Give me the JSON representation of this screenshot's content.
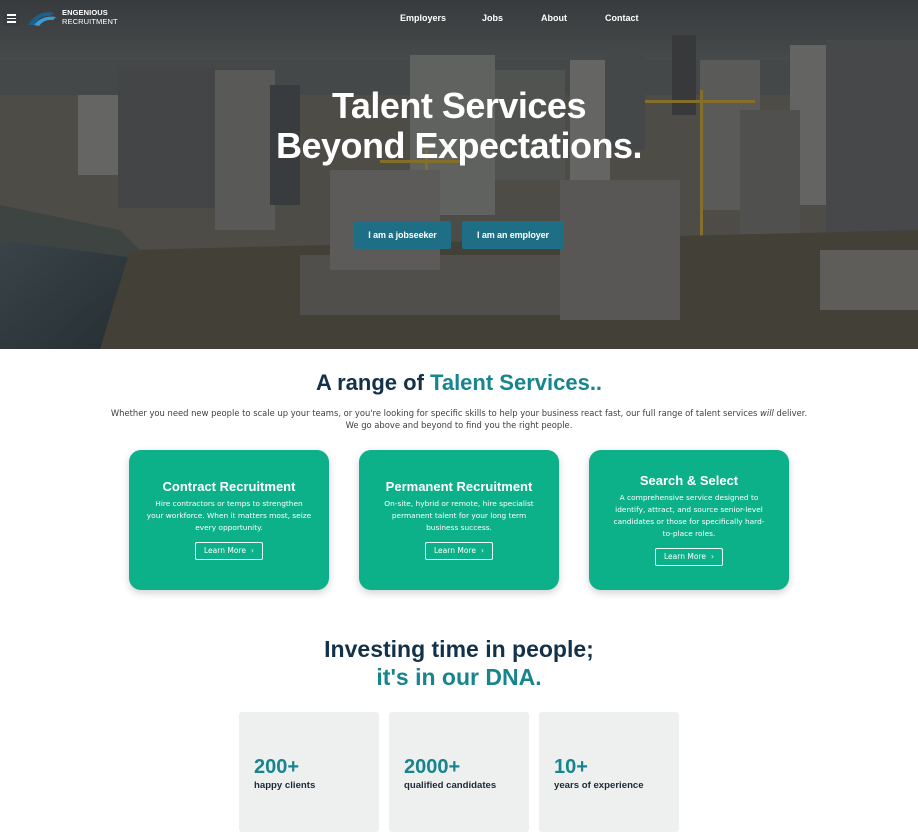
{
  "brand": {
    "line1": "ENGENIOUS",
    "line2": "RECRUITMENT"
  },
  "nav": {
    "items": [
      "Employers",
      "Jobs",
      "About",
      "Contact"
    ]
  },
  "hero": {
    "title_line1": "Talent Services",
    "title_line2": "Beyond Expectations.",
    "cta_jobseeker": "I am a jobseeker",
    "cta_employer": "I am an employer"
  },
  "services": {
    "title_prefix": "A range of ",
    "title_accent": "Talent Services..",
    "intro_line1_a": "Whether you need new people to scale up your teams, or you're looking for specific skills to help your business react fast, our full range of talent services ",
    "intro_line1_em": "will",
    "intro_line1_b": " deliver.",
    "intro_line2": "We go above and beyond to find you the right people.",
    "cards": [
      {
        "title": "Contract Recruitment",
        "desc": [
          "Hire contractors or temps to strengthen",
          "your workforce. When it matters most, seize",
          "every opportunity."
        ],
        "button": "Learn More"
      },
      {
        "title": "Permanent Recruitment",
        "desc": [
          "On-site, hybrid or remote, hire specialist",
          "permanent talent for your long term",
          "business success."
        ],
        "button": "Learn More"
      },
      {
        "title": "Search & Select",
        "desc": [
          "A comprehensive service designed to",
          "identify, attract, and source senior-level",
          "candidates or those for specifically hard-",
          "to-place roles."
        ],
        "button": "Learn More"
      }
    ]
  },
  "dna": {
    "line1": "Investing time in people;",
    "line2": "it's in our DNA."
  },
  "stats": [
    {
      "number": "200+",
      "label": "happy clients"
    },
    {
      "number": "2000+",
      "label": "qualified candidates"
    },
    {
      "number": "10+",
      "label": "years of experience"
    }
  ],
  "colors": {
    "accent_teal": "#16858e",
    "card_green": "#0db189",
    "cta_blue": "#1e6f86",
    "heading_navy": "#13324a"
  }
}
